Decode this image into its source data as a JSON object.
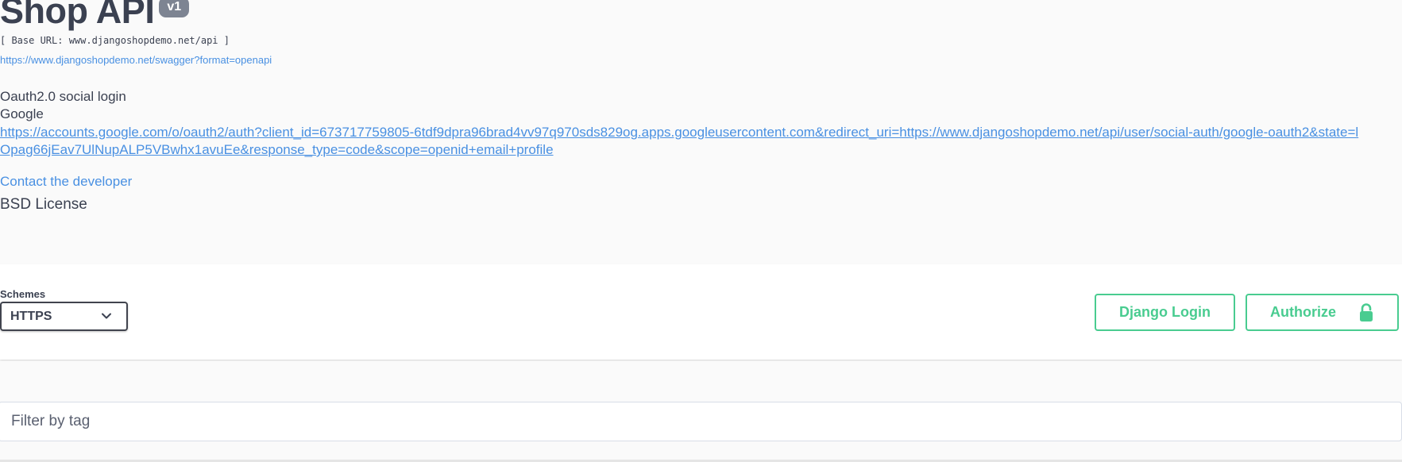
{
  "info": {
    "title": "Shop API",
    "version": "v1",
    "base_url": "[ Base URL: www.djangoshopdemo.net/api ]",
    "spec_link": "https://www.djangoshopdemo.net/swagger?format=openapi",
    "description_heading": "Oauth2.0 social login",
    "description_provider": "Google",
    "oauth_link": "https://accounts.google.com/o/oauth2/auth?client_id=673717759805-6tdf9dpra96brad4vv97q970sds829og.apps.googleusercontent.com&redirect_uri=https://www.djangoshopdemo.net/api/user/social-auth/google-oauth2&state=lOpag66jEav7UlNupALP5VBwhx1avuEe&response_type=code&scope=openid+email+profile",
    "contact": "Contact the developer",
    "license": "BSD License"
  },
  "schemes": {
    "label": "Schemes",
    "selected": "HTTPS"
  },
  "buttons": {
    "django_login": "Django Login",
    "authorize": "Authorize"
  },
  "filter": {
    "placeholder": "Filter by tag"
  },
  "colors": {
    "accent_green": "#49cc90",
    "link_blue": "#4990e2",
    "text": "#3b4151"
  },
  "icons": {
    "schemes_dropdown": "chevron-down-icon",
    "authorize": "unlocked-padlock-icon"
  }
}
